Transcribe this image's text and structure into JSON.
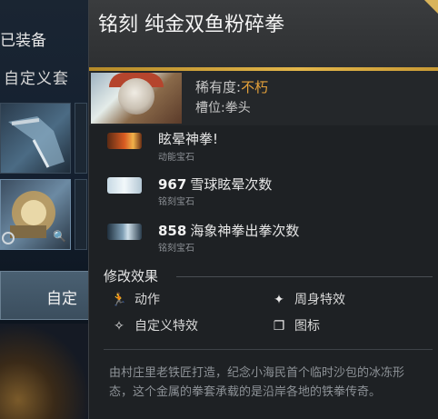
{
  "background": {
    "equipped_label": "已装备",
    "custom_set_label": "自定义套",
    "equip_button_label": "自定"
  },
  "tooltip": {
    "title": "铭刻 纯金双鱼粉碎拳",
    "rarity_label": "稀有度:",
    "rarity_value": "不朽",
    "slot_label": "槽位:",
    "slot_value": "拳头",
    "rarity_color": "#e6a23a",
    "gems": [
      {
        "count": "",
        "label": "眩晕神拳!",
        "type": "动能宝石",
        "icon": "kinetic-gem-icon"
      },
      {
        "count": "967",
        "label": "雪球眩晕次数",
        "type": "铭刻宝石",
        "icon": "inscribed-gem-icon"
      },
      {
        "count": "858",
        "label": "海象神拳出拳次数",
        "type": "铭刻宝石",
        "icon": "inscribed-gem-icon"
      }
    ],
    "modifiers_title": "修改效果",
    "modifiers": [
      {
        "label": "动作",
        "icon": "animation-icon"
      },
      {
        "label": "周身特效",
        "icon": "ambient-effect-icon"
      },
      {
        "label": "自定义特效",
        "icon": "custom-effect-icon"
      },
      {
        "label": "图标",
        "icon": "icon-set-icon"
      }
    ],
    "description": "由村庄里老铁匠打造，纪念小海民首个临时沙包的冰冻形态，这个金属的拳套承载的是沿岸各地的铁拳传奇。"
  }
}
